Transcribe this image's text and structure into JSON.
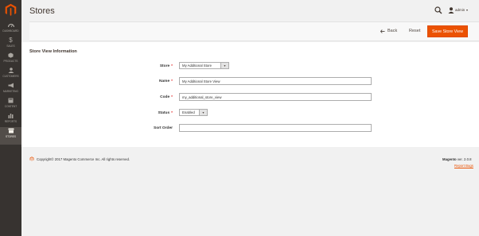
{
  "sidebar": {
    "items": [
      {
        "label": "Dashboard",
        "icon": "dashboard-icon"
      },
      {
        "label": "Sales",
        "icon": "dollar-icon"
      },
      {
        "label": "Products",
        "icon": "cube-icon"
      },
      {
        "label": "Customers",
        "icon": "customers-icon"
      },
      {
        "label": "Marketing",
        "icon": "megaphone-icon"
      },
      {
        "label": "Content",
        "icon": "content-icon"
      },
      {
        "label": "Reports",
        "icon": "bar-chart-icon"
      },
      {
        "label": "Stores",
        "icon": "store-icon"
      }
    ],
    "active": "Stores"
  },
  "header": {
    "title": "Stores",
    "user": "admin"
  },
  "actions": {
    "back": "Back",
    "reset": "Reset",
    "save": "Save Store View"
  },
  "form": {
    "section_title": "Store View Information",
    "store_label": "Store",
    "store_value": "My Additional Store",
    "name_label": "Name",
    "name_value": "My Additional Store View",
    "code_label": "Code",
    "code_value": "my_additional_store_view",
    "status_label": "Status",
    "status_value": "Enabled",
    "sort_label": "Sort Order",
    "sort_value": ""
  },
  "footer": {
    "copyright": "Copyright© 2017 Magento Commerce Inc. All rights reserved.",
    "version_brand": "Magento",
    "version_text": "ver. 2.0.8",
    "report_bugs": "Report Bugs"
  },
  "colors": {
    "sidebar_bg": "#373330",
    "accent": "#eb5202",
    "required": "#e22626"
  }
}
